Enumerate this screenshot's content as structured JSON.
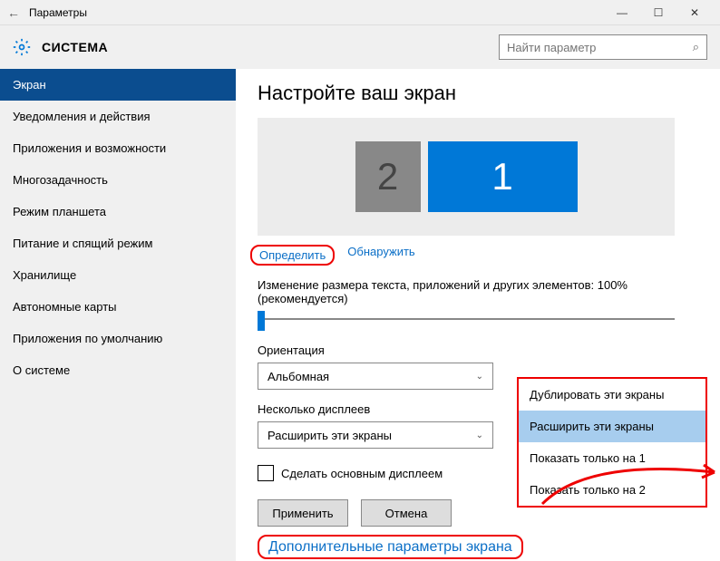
{
  "titlebar": {
    "title": "Параметры"
  },
  "header": {
    "title": "СИСТЕМА",
    "search_placeholder": "Найти параметр"
  },
  "sidebar": {
    "items": [
      "Экран",
      "Уведомления и действия",
      "Приложения и возможности",
      "Многозадачность",
      "Режим планшета",
      "Питание и спящий режим",
      "Хранилище",
      "Автономные карты",
      "Приложения по умолчанию",
      "О системе"
    ],
    "active_index": 0
  },
  "main": {
    "title": "Настройте ваш экран",
    "display2": "2",
    "display1": "1",
    "link_identify": "Определить",
    "link_detect": "Обнаружить",
    "scale_label": "Изменение размера текста, приложений и других элементов: 100% (рекомендуется)",
    "orientation_label": "Ориентация",
    "orientation_value": "Альбомная",
    "multimon_label": "Несколько дисплеев",
    "multimon_value": "Расширить эти экраны",
    "checkbox_label": "Сделать основным дисплеем",
    "btn_apply": "Применить",
    "btn_cancel": "Отмена",
    "advanced_link": "Дополнительные параметры экрана"
  },
  "dropdown_options": [
    "Дублировать эти экраны",
    "Расширить эти экраны",
    "Показать только на 1",
    "Показать только на 2"
  ],
  "dropdown_selected_index": 1
}
